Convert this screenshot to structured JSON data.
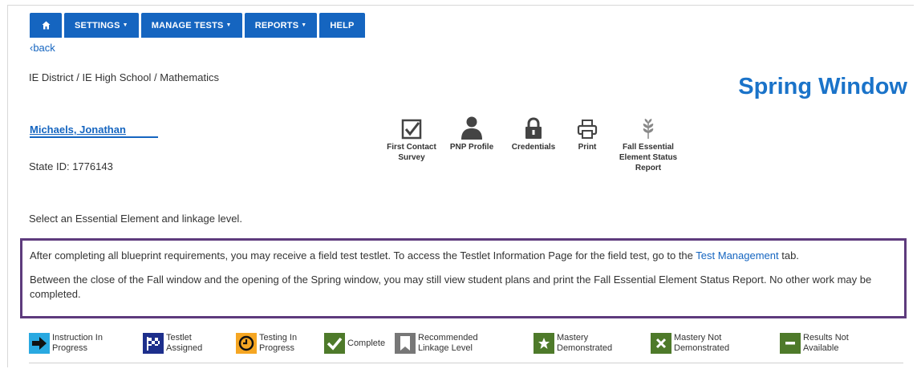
{
  "nav": {
    "home_icon": "home-icon",
    "items": [
      {
        "label": "SETTINGS",
        "has_menu": true
      },
      {
        "label": "MANAGE TESTS",
        "has_menu": true
      },
      {
        "label": "REPORTS",
        "has_menu": true
      },
      {
        "label": "HELP",
        "has_menu": false
      }
    ],
    "color": "#1565c0"
  },
  "back_link": "‹back",
  "breadcrumb": "IE District / IE High School / Mathematics",
  "window_title": "Spring Window",
  "student": {
    "name": "Michaels, Jonathan",
    "state_id": "State ID: 1776143"
  },
  "toolbar": [
    {
      "icon": "checkbox-icon",
      "label": "First Contact Survey"
    },
    {
      "icon": "person-icon",
      "label": "PNP Profile"
    },
    {
      "icon": "lock-icon",
      "label": "Credentials"
    },
    {
      "icon": "printer-icon",
      "label": "Print"
    },
    {
      "icon": "leaf-icon",
      "label": "Fall Essential Element Status Report"
    }
  ],
  "instruction": "Select an Essential Element and linkage level.",
  "notice": {
    "line1_before": "After completing all blueprint requirements, you may receive a field test testlet. To access the Testlet Information Page for the field test, go to the ",
    "line1_link": "Test Management",
    "line1_after": " tab.",
    "line2": "Between the close of the Fall window and the opening of the Spring window, you may still view student plans and print the Fall Essential Element Status Report. No other work may be completed.",
    "border_color": "#5e3b7d"
  },
  "legend": [
    {
      "icon": "arrow-right-icon",
      "label": "Instruction In Progress",
      "bg": "#29a9e1"
    },
    {
      "icon": "checkered-flag-icon",
      "label": "Testlet Assigned",
      "bg": "#1d2f8c"
    },
    {
      "icon": "clock-icon",
      "label": "Testing In Progress",
      "bg": "#f5a623"
    },
    {
      "icon": "checkmark-icon",
      "label": "Complete",
      "bg": "#4e7a2a"
    },
    {
      "icon": "bookmark-icon",
      "label": "Recommended Linkage Level",
      "bg": "#777777"
    },
    {
      "icon": "star-icon",
      "label": "Mastery Demonstrated",
      "bg": "#4e7a2a"
    },
    {
      "icon": "x-icon",
      "label": "Mastery Not Demonstrated",
      "bg": "#4e7a2a"
    },
    {
      "icon": "minus-icon",
      "label": "Results Not Available",
      "bg": "#4e7a2a"
    }
  ]
}
